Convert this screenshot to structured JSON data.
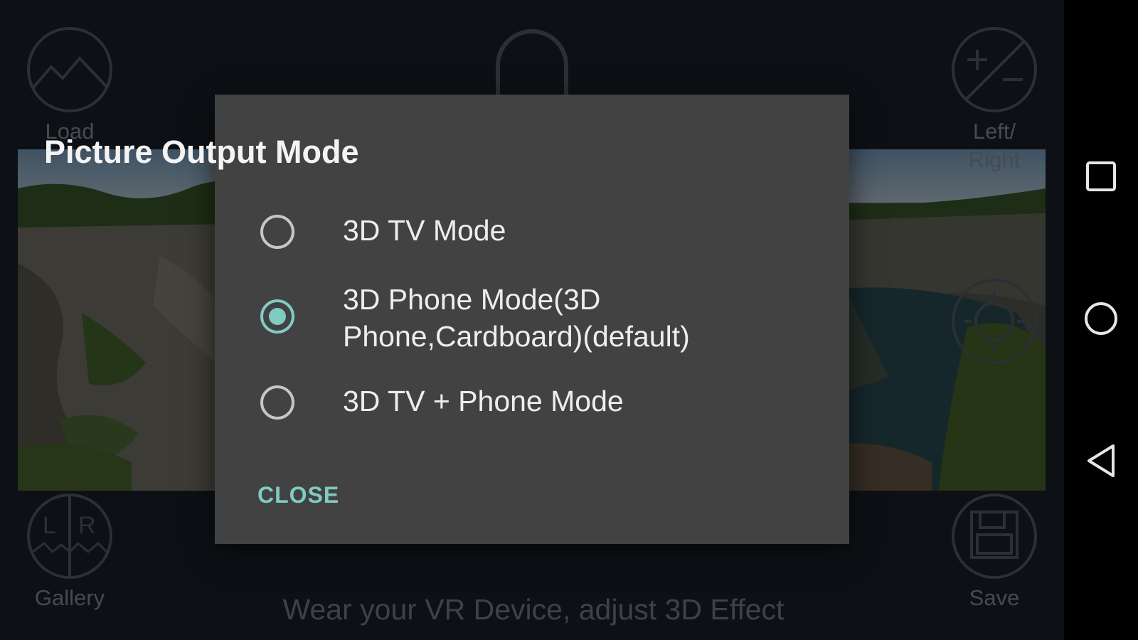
{
  "app": {
    "tools": {
      "load": "Load",
      "left_right_line1": "Left/",
      "left_right_line2": "Right",
      "gallery": "Gallery",
      "save": "Save"
    },
    "hint": "Wear your VR Device, adjust 3D Effect"
  },
  "dialog": {
    "title": "Picture Output Mode",
    "options": [
      {
        "label": "3D TV Mode",
        "selected": false
      },
      {
        "label_line1": "3D Phone Mode(3D",
        "label_line2": "Phone,Cardboard)(default)",
        "selected": true
      },
      {
        "label": "3D TV + Phone Mode",
        "selected": false
      }
    ],
    "close_label": "CLOSE"
  },
  "colors": {
    "accent": "#80cbc4",
    "dialog_bg": "#424242",
    "app_bg": "#1a222b"
  },
  "navbar": {
    "icons": [
      "recents-square-icon",
      "home-circle-icon",
      "back-triangle-icon"
    ]
  }
}
